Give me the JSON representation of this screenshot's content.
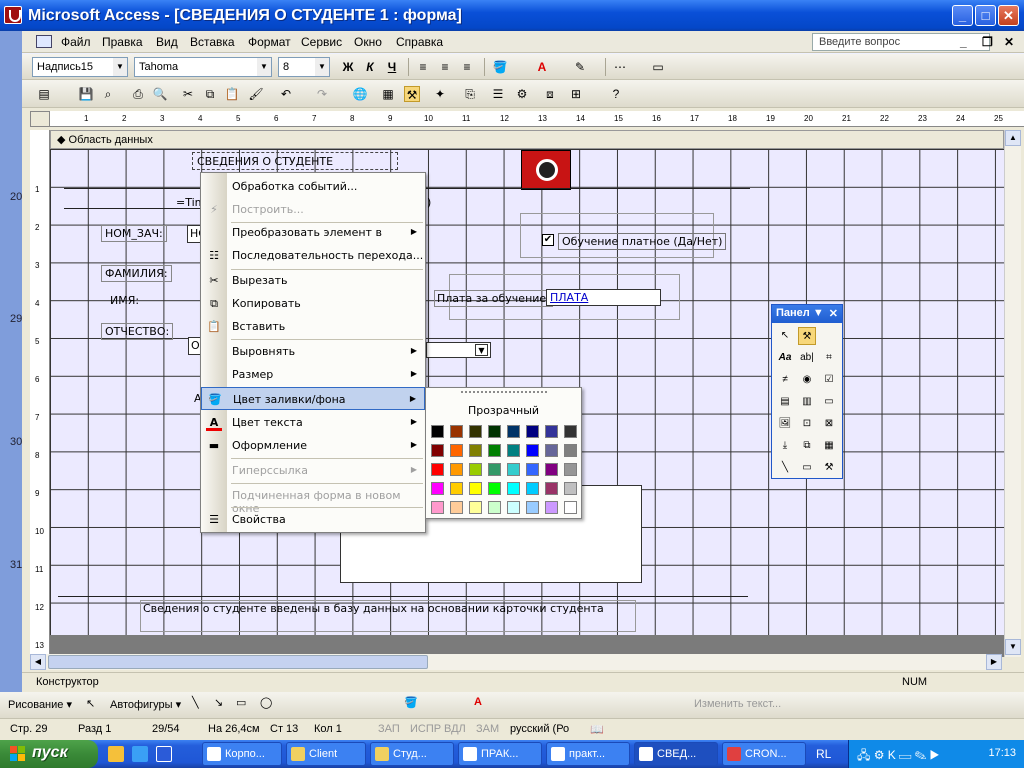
{
  "window": {
    "title": "Microsoft Access - [СВЕДЕНИЯ О СТУДЕНТЕ 1 : форма]"
  },
  "menubar": {
    "items": [
      "Файл",
      "Правка",
      "Вид",
      "Вставка",
      "Формат",
      "Сервис",
      "Окно",
      "Справка"
    ],
    "ask_placeholder": "Введите вопрос"
  },
  "format_toolbar": {
    "object": "Надпись15",
    "font": "Tahoma",
    "size": "8"
  },
  "ruler": {
    "ticks": [
      "1",
      "2",
      "3",
      "4",
      "5",
      "6",
      "7",
      "8",
      "9",
      "10",
      "11",
      "12",
      "13",
      "14",
      "15",
      "16",
      "17",
      "18",
      "19",
      "20",
      "21",
      "22",
      "23",
      "24",
      "25"
    ],
    "left_ticks": [
      "1",
      "2",
      "3",
      "4",
      "5",
      "6",
      "7",
      "8",
      "9",
      "10",
      "11",
      "12",
      "13"
    ]
  },
  "left_strip_numbers": [
    "20",
    "29",
    "30",
    "31"
  ],
  "section": {
    "label": "Область данных"
  },
  "form": {
    "title_label": "СВЕДЕНИЯ О СТУДЕНТЕ",
    "time_field": "=Tim",
    "time_field_tail": ")",
    "lbl_nomzach": "НОМ_ЗАЧ:",
    "txt_nomzach": "НС",
    "lbl_familiya": "ФАМИЛИЯ:",
    "lbl_imya": "ИМЯ:",
    "lbl_otchestvo": "ОТЧЕСТВО:",
    "txt_otchestvo": "О",
    "lbl_a": "А",
    "checkbox_label": "Обучение платное (Да/Нет)",
    "checkbox_mark": "✔",
    "payment_label": "Плата за обучение:",
    "payment_field": "ПЛАТА",
    "footer_text": "Сведения о студенте введены в базу данных на основании карточки студента"
  },
  "context_menu": {
    "items": [
      {
        "label": "Обработка событий...",
        "state": "enabled"
      },
      {
        "label": "Построить...",
        "state": "disabled"
      },
      {
        "label": "Преобразовать элемент в",
        "state": "enabled"
      },
      {
        "label": "Последовательность перехода...",
        "state": "enabled"
      },
      {
        "label": "Вырезать",
        "state": "enabled"
      },
      {
        "label": "Копировать",
        "state": "enabled"
      },
      {
        "label": "Вставить",
        "state": "enabled"
      },
      {
        "label": "Выровнять",
        "state": "enabled"
      },
      {
        "label": "Размер",
        "state": "enabled"
      },
      {
        "label": "Цвет заливки/фона",
        "state": "highlighted"
      },
      {
        "label": "Цвет текста",
        "state": "enabled"
      },
      {
        "label": "Оформление",
        "state": "enabled"
      },
      {
        "label": "Гиперссылка",
        "state": "disabled"
      },
      {
        "label": "Подчиненная форма в новом окне",
        "state": "disabled"
      },
      {
        "label": "Свойства",
        "state": "enabled"
      }
    ]
  },
  "palette": {
    "transparent_label": "Прозрачный",
    "rows": [
      [
        "#000000",
        "#993300",
        "#333300",
        "#003300",
        "#003366",
        "#000080",
        "#333399",
        "#333333"
      ],
      [
        "#800000",
        "#FF6600",
        "#808000",
        "#008000",
        "#008080",
        "#0000FF",
        "#666699",
        "#808080"
      ],
      [
        "#FF0000",
        "#FF9900",
        "#99CC00",
        "#339966",
        "#33CCCC",
        "#3366FF",
        "#800080",
        "#969696"
      ],
      [
        "#FF00FF",
        "#FFCC00",
        "#FFFF00",
        "#00FF00",
        "#00FFFF",
        "#00CCFF",
        "#993366",
        "#C0C0C0"
      ],
      [
        "#FF99CC",
        "#FFCC99",
        "#FFFF99",
        "#CCFFCC",
        "#CCFFFF",
        "#99CCFF",
        "#CC99FF",
        "#FFFFFF"
      ]
    ]
  },
  "toolbox": {
    "title": "Панел"
  },
  "statusbar": {
    "mode": "Конструктор",
    "num": "NUM"
  },
  "drawbar": {
    "draw": "Рисование",
    "autoshapes": "Автофигуры",
    "change_text": "Изменить текст..."
  },
  "word_status": {
    "page": "Стр. 29",
    "section": "Разд 1",
    "pages": "29/54",
    "at": "На 26,4см",
    "line": "Ст 13",
    "col": "Кол 1",
    "zap": "ЗАП",
    "ispr": "ИСПР",
    "vdl": "ВДЛ",
    "zam": "ЗАМ",
    "lang": "русский (Ро"
  },
  "taskbar": {
    "start": "пуск",
    "tasks": [
      "Корпо...",
      "Client",
      "Студ...",
      "ПРАК...",
      "практ...",
      "СВЕД...",
      "CRON..."
    ],
    "lang": "RL",
    "clock": "17:13"
  }
}
